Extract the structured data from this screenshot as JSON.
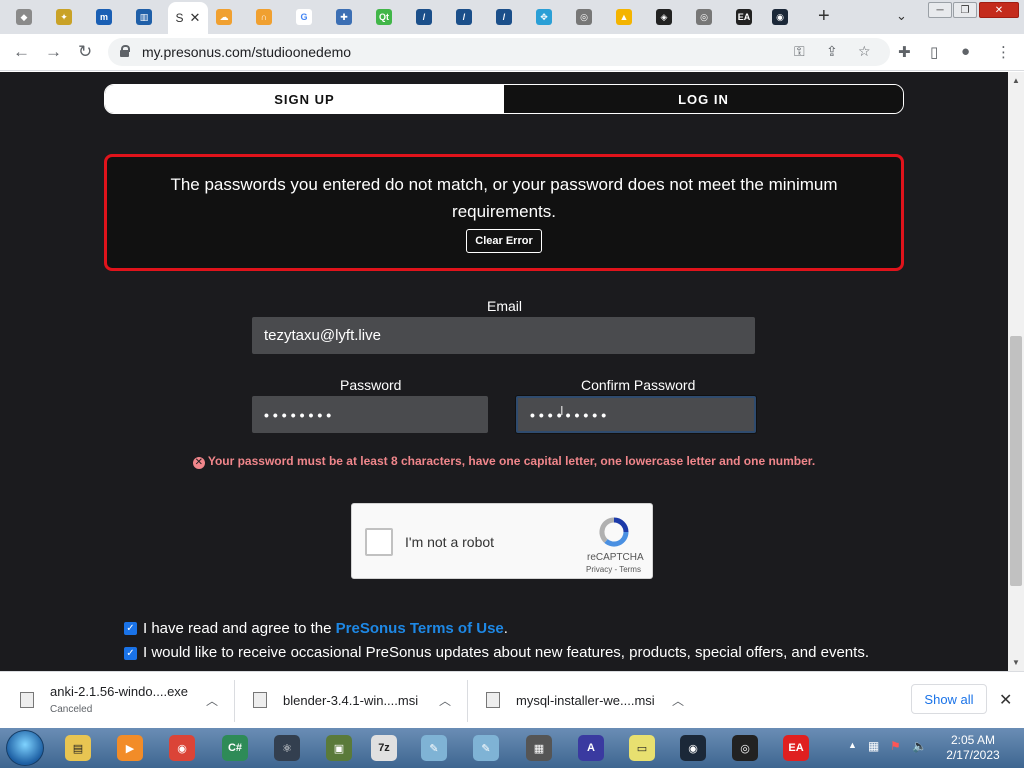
{
  "browser": {
    "active_tab_title": "S",
    "url": "my.presonus.com/studioonedemo",
    "tabs": [
      {
        "icon": "gem-icon",
        "color": "#8a8a8a",
        "glyph": "◆"
      },
      {
        "icon": "ninja-icon",
        "color": "#c9a227",
        "glyph": "✦"
      },
      {
        "icon": "m-app-icon",
        "color": "#1a5fb4",
        "glyph": "m"
      },
      {
        "icon": "waveform-icon",
        "color": "#1f5fa8",
        "glyph": "▥"
      },
      {
        "icon": "cloud-upload-icon",
        "color": "#f0a030",
        "glyph": "☁"
      },
      {
        "icon": "headphones-icon",
        "color": "#f0a030",
        "glyph": "∩"
      },
      {
        "icon": "google-icon",
        "color": "#ffffff",
        "glyph": "G"
      },
      {
        "icon": "puzzle-icon",
        "color": "#3c6fb4",
        "glyph": "✚"
      },
      {
        "icon": "qt-icon",
        "color": "#41b649",
        "glyph": "Qt"
      },
      {
        "icon": "studio-one-icon",
        "color": "#1b4f8a",
        "glyph": "/"
      },
      {
        "icon": "studio-one-icon",
        "color": "#1b4f8a",
        "glyph": "/"
      },
      {
        "icon": "studio-one-icon",
        "color": "#1b4f8a",
        "glyph": "/"
      },
      {
        "icon": "diamond-grid-icon",
        "color": "#2a9fd6",
        "glyph": "✥"
      },
      {
        "icon": "globe-icon",
        "color": "#777777",
        "glyph": "◎"
      },
      {
        "icon": "google-drive-icon",
        "color": "#f4b400",
        "glyph": "▲"
      },
      {
        "icon": "unity-icon",
        "color": "#222222",
        "glyph": "◈"
      },
      {
        "icon": "globe-icon",
        "color": "#777777",
        "glyph": "◎"
      },
      {
        "icon": "ea-icon",
        "color": "#222222",
        "glyph": "EA"
      },
      {
        "icon": "steam-icon",
        "color": "#1b2838",
        "glyph": "◉"
      }
    ]
  },
  "page": {
    "toggle": {
      "signup": "SIGN UP",
      "login": "LOG IN"
    },
    "error": {
      "message": "The passwords you entered do not match, or your password does not meet the minimum requirements.",
      "clear_button": "Clear Error"
    },
    "form": {
      "email_label": "Email",
      "email_value": "tezytaxu@lyft.live",
      "password_label": "Password",
      "password_value": "••••••••",
      "confirm_label": "Confirm Password",
      "confirm_value": "•••••••••",
      "password_error": "Your password must be at least 8 characters, have one capital letter, one lowercase letter and one number."
    },
    "recaptcha": {
      "label": "I'm not a robot",
      "brand": "reCAPTCHA",
      "links": "Privacy - Terms"
    },
    "terms": {
      "prefix": "I have read and agree to the ",
      "link": "PreSonus Terms of Use",
      "suffix": ".",
      "checked": true
    },
    "updates": {
      "label": "I would like to receive occasional PreSonus updates about new features, products, special offers, and events.",
      "checked": true
    }
  },
  "downloads": {
    "items": [
      {
        "name": "anki-2.1.56-windo....exe",
        "status": "Canceled"
      },
      {
        "name": "blender-3.4.1-win....msi",
        "status": ""
      },
      {
        "name": "mysql-installer-we....msi",
        "status": ""
      }
    ],
    "show_all": "Show all"
  },
  "taskbar": {
    "apps": [
      {
        "icon": "file-explorer-icon",
        "color": "#e8c552",
        "glyph": "▤"
      },
      {
        "icon": "media-player-icon",
        "color": "#f28c28",
        "glyph": "▶"
      },
      {
        "icon": "chrome-icon",
        "color": "#db4437",
        "glyph": "◉"
      },
      {
        "icon": "csharp-icon",
        "color": "#2e8b57",
        "glyph": "C#"
      },
      {
        "icon": "atom-icon",
        "color": "#333f4f",
        "glyph": "⚛"
      },
      {
        "icon": "monitor-icon",
        "color": "#5a7a3a",
        "glyph": "▣"
      },
      {
        "icon": "7zip-icon",
        "color": "#e0e0e0",
        "glyph": "7z"
      },
      {
        "icon": "notepad-icon",
        "color": "#7fb3d5",
        "glyph": "✎"
      },
      {
        "icon": "notepad-icon",
        "color": "#7fb3d5",
        "glyph": "✎"
      },
      {
        "icon": "chip-icon",
        "color": "#555555",
        "glyph": "▦"
      },
      {
        "icon": "arc-icon",
        "color": "#3a3aa0",
        "glyph": "A"
      },
      {
        "icon": "sticky-notes-icon",
        "color": "#e8e070",
        "glyph": "▭"
      },
      {
        "icon": "steam-icon",
        "color": "#1b2838",
        "glyph": "◉"
      },
      {
        "icon": "ubisoft-icon",
        "color": "#222222",
        "glyph": "◎"
      },
      {
        "icon": "ea-icon",
        "color": "#e02020",
        "glyph": "EA"
      }
    ],
    "time": "2:05 AM",
    "date": "2/17/2023"
  }
}
